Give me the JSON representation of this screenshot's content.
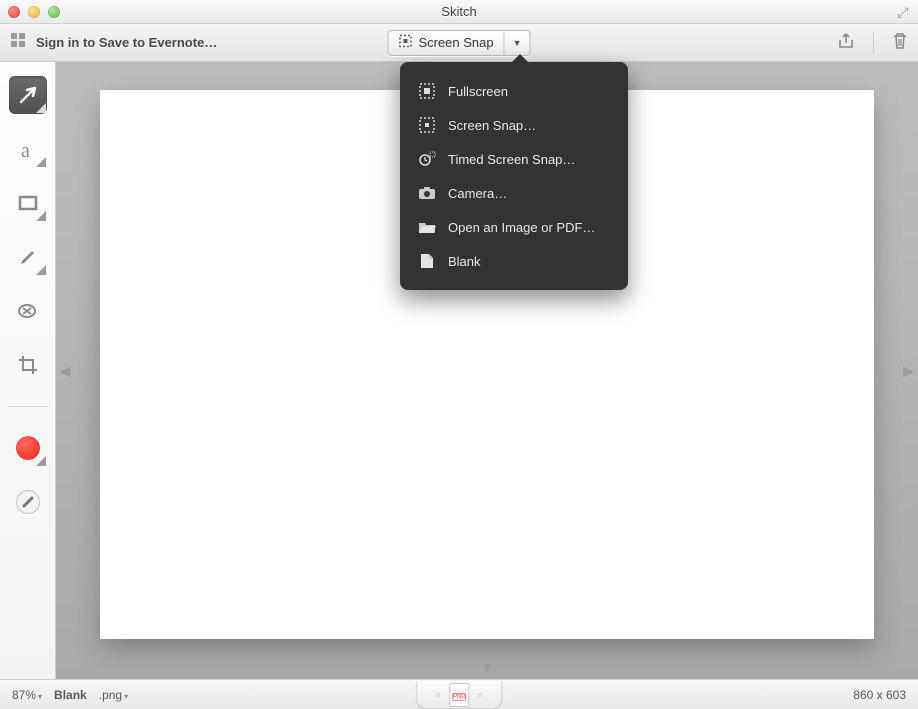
{
  "app": {
    "title": "Skitch"
  },
  "toolbar": {
    "signin_label": "Sign in to Save to Evernote…",
    "snap_button_label": "Screen Snap"
  },
  "dropdown": {
    "items": [
      {
        "icon": "fullscreen-icon",
        "label": "Fullscreen"
      },
      {
        "icon": "screensnap-icon",
        "label": "Screen Snap…"
      },
      {
        "icon": "timed-snap-icon",
        "label": "Timed Screen Snap…"
      },
      {
        "icon": "camera-icon",
        "label": "Camera…"
      },
      {
        "icon": "open-file-icon",
        "label": "Open an Image or PDF…"
      },
      {
        "icon": "blank-page-icon",
        "label": "Blank"
      }
    ]
  },
  "sidebar_tools": [
    {
      "id": "arrow-tool",
      "active": true
    },
    {
      "id": "text-tool",
      "active": false
    },
    {
      "id": "shape-tool",
      "active": false
    },
    {
      "id": "pen-tool",
      "active": false
    },
    {
      "id": "stamp-tool",
      "active": false
    },
    {
      "id": "crop-tool",
      "active": false
    }
  ],
  "status": {
    "zoom": "87%",
    "filename": "Blank",
    "ext": ".png",
    "dimensions": "860 x 603",
    "badge_type": "PNG"
  }
}
